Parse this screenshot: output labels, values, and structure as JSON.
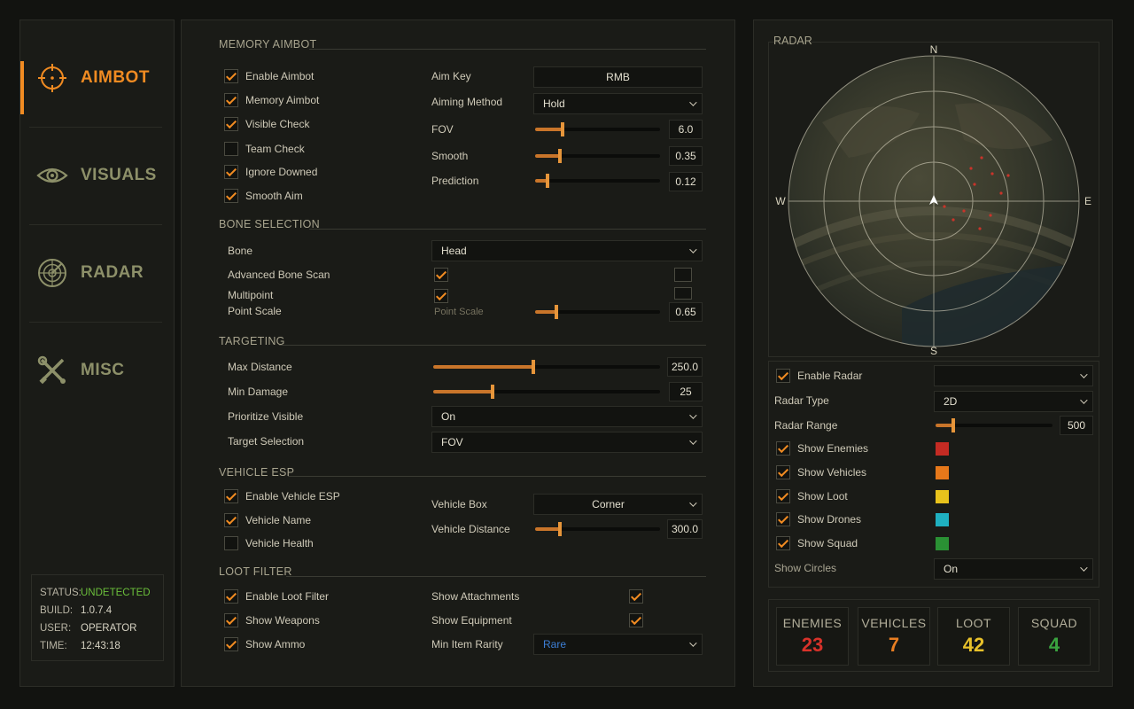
{
  "nav": {
    "items": [
      {
        "label": "AIMBOT",
        "icon": "crosshair-icon",
        "active": true
      },
      {
        "label": "VISUALS",
        "icon": "eye-icon",
        "active": false
      },
      {
        "label": "RADAR",
        "icon": "radar-icon",
        "active": false
      },
      {
        "label": "MISC",
        "icon": "tools-icon",
        "active": false
      }
    ],
    "status": {
      "status_key": "STATUS:",
      "status_val": "UNDETECTED",
      "build_key": "BUILD:",
      "build_val": "1.0.7.4",
      "user_key": "USER:",
      "user_val": "OPERATOR",
      "time_key": "TIME:",
      "time_val": "12:43:18"
    }
  },
  "memory_aimbot": {
    "title": "MEMORY AIMBOT",
    "checks": [
      {
        "label": "Enable Aimbot",
        "checked": true
      },
      {
        "label": "Memory Aimbot",
        "checked": true
      },
      {
        "label": "Visible Check",
        "checked": true
      },
      {
        "label": "Team Check",
        "checked": false
      },
      {
        "label": "Ignore Downed",
        "checked": true
      },
      {
        "label": "Smooth Aim",
        "checked": true
      }
    ],
    "aim_key_label": "Aim Key",
    "aim_key_value": "RMB",
    "aiming_method_label": "Aiming Method",
    "aiming_method_value": "Hold",
    "fov_label": "FOV",
    "fov_value": "6.0",
    "fov_level": 0.22,
    "smooth_label": "Smooth",
    "smooth_value": "0.35",
    "smooth_level": 0.2,
    "prediction_label": "Prediction",
    "prediction_value": "0.12",
    "prediction_level": 0.1
  },
  "bone_selection": {
    "title": "BONE SELECTION",
    "bone_label": "Bone",
    "bone_value": "Head",
    "adv_scan_label": "Advanced Bone Scan",
    "adv_scan_checked": true,
    "multipoint_label": "Multipoint",
    "multipoint_checked": true,
    "point_scale_label": "Point Scale",
    "point_scale_label2": "Point Scale",
    "point_scale_value": "0.65",
    "point_scale_level": 0.17
  },
  "targeting": {
    "title": "TARGETING",
    "max_distance_label": "Max Distance",
    "max_distance_value": "250.0",
    "max_distance_level": 0.44,
    "min_damage_label": "Min Damage",
    "min_damage_value": "25",
    "min_damage_level": 0.26,
    "prioritize_label": "Prioritize Visible",
    "prioritize_value": "On",
    "target_sel_label": "Target Selection",
    "target_sel_value": "FOV"
  },
  "vehicle_esp": {
    "title": "VEHICLE ESP",
    "checks": [
      {
        "label": "Enable Vehicle ESP",
        "checked": true
      },
      {
        "label": "Vehicle Name",
        "checked": true
      },
      {
        "label": "Vehicle Health",
        "checked": false
      }
    ],
    "box_label": "Vehicle Box",
    "box_value": "Corner",
    "distance_label": "Vehicle Distance",
    "distance_value": "300.0",
    "distance_level": 0.2
  },
  "loot_filter": {
    "title": "LOOT FILTER",
    "checks": [
      {
        "label": "Enable Loot Filter",
        "checked": true
      },
      {
        "label": "Show Weapons",
        "checked": true
      },
      {
        "label": "Show Ammo",
        "checked": true
      }
    ],
    "attachments_label": "Show Attachments",
    "attachments_checked": true,
    "equipment_label": "Show Equipment",
    "equipment_checked": true,
    "rarity_label": "Min Item Rarity",
    "rarity_value": "Rare",
    "rarity_color": "#3d7fd6"
  },
  "radar": {
    "title": "RADAR",
    "n": "N",
    "s": "S",
    "e": "E",
    "w": "W",
    "enable_label": "Enable Radar",
    "enable_checked": true,
    "enable_value": "",
    "type_label": "Radar Type",
    "type_value": "2D",
    "range_label": "Radar Range",
    "range_value": "500",
    "range_level": 0.15,
    "toggles": [
      {
        "label": "Show Enemies",
        "checked": true,
        "color": "#c42b23"
      },
      {
        "label": "Show Vehicles",
        "checked": true,
        "color": "#e6781a"
      },
      {
        "label": "Show Loot",
        "checked": true,
        "color": "#e8c31c"
      },
      {
        "label": "Show Drones",
        "checked": true,
        "color": "#1fb0c0"
      },
      {
        "label": "Show Squad",
        "checked": true,
        "color": "#2a9134"
      }
    ],
    "circles_label": "Show Circles",
    "circles_value": "On"
  },
  "counters": [
    {
      "label": "ENEMIES",
      "value": "23",
      "color": "#d8322a"
    },
    {
      "label": "VEHICLES",
      "value": "7",
      "color": "#e87e22"
    },
    {
      "label": "LOOT",
      "value": "42",
      "color": "#e8c12a"
    },
    {
      "label": "SQUAD",
      "value": "4",
      "color": "#3aa33f"
    }
  ],
  "colors": {
    "accent": "#f08b22",
    "bg": "#121310",
    "panel": "#1a1b17",
    "ok": "#6bbf3b"
  }
}
